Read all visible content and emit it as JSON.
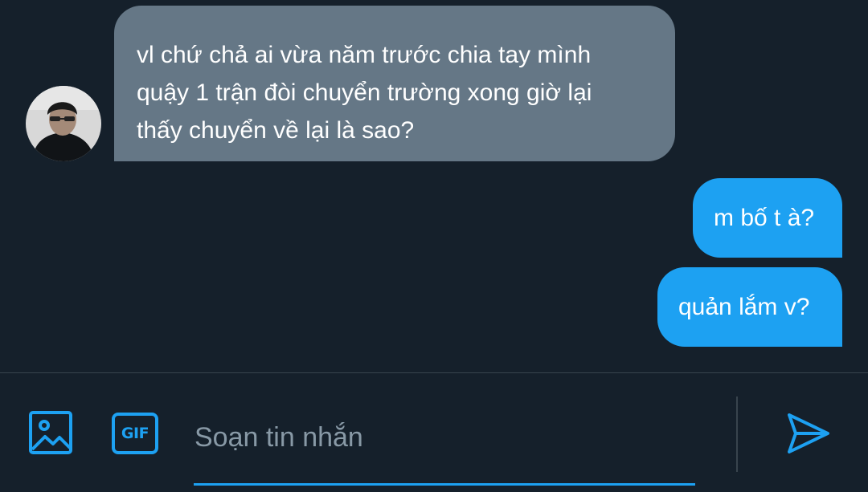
{
  "conversation": {
    "received": {
      "lines": [
        "vl chứ chả ai vừa năm trước chia tay mình",
        "quậy 1 trận đòi chuyển trường xong giờ lại",
        "thấy chuyển về lại là sao?"
      ]
    },
    "sent": [
      {
        "text": "m bố t à?"
      },
      {
        "text": "quản lắm v?"
      }
    ]
  },
  "composer": {
    "image_icon": "image-icon",
    "gif_label": "GIF",
    "placeholder": "Soạn tin nhắn",
    "send_icon": "send-icon"
  },
  "colors": {
    "background": "#15202b",
    "received_bubble": "#657786",
    "sent_bubble": "#1da1f2",
    "accent": "#1da1f2"
  }
}
